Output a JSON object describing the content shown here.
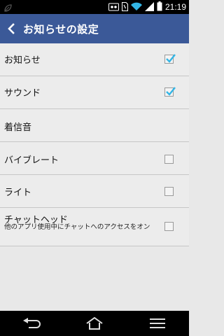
{
  "status_bar": {
    "time": "21:19",
    "icons": [
      "leaf-icon",
      "voicemail-icon",
      "sim-icon",
      "wifi-icon",
      "signal-icon",
      "battery-icon"
    ]
  },
  "action_bar": {
    "title": "お知らせの設定",
    "back_icon": "chevron-left-icon",
    "background": "#3b5998"
  },
  "settings": [
    {
      "label": "お知らせ",
      "has_checkbox": true,
      "checked": true
    },
    {
      "label": "サウンド",
      "has_checkbox": true,
      "checked": true
    },
    {
      "label": "着信音",
      "has_checkbox": false
    },
    {
      "label": "バイブレート",
      "has_checkbox": true,
      "checked": false
    },
    {
      "label": "ライト",
      "has_checkbox": true,
      "checked": false
    },
    {
      "label": "チャットヘッド",
      "sublabel": "他のアプリ使用中にチャットへのアクセスをオン",
      "has_checkbox": true,
      "checked": false
    }
  ],
  "nav_bar": {
    "buttons": [
      "back-icon",
      "home-icon",
      "recent-apps-icon"
    ]
  },
  "colors": {
    "accent": "#33b5e5",
    "background": "#e8e8e8"
  }
}
